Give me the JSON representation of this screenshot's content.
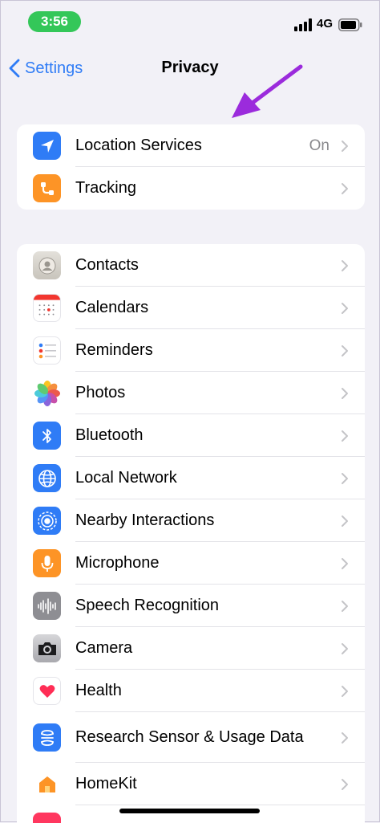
{
  "status_bar": {
    "time": "3:56",
    "network": "4G"
  },
  "nav": {
    "back_label": "Settings",
    "title": "Privacy"
  },
  "colors": {
    "accent": "#2f7cf6",
    "annotation_arrow": "#9b2bdc",
    "time_pill": "#34c759"
  },
  "group1": [
    {
      "label": "Location Services",
      "value": "On",
      "icon": "location-arrow-icon"
    },
    {
      "label": "Tracking",
      "value": "",
      "icon": "tracking-icon"
    }
  ],
  "group2": [
    {
      "label": "Contacts",
      "icon": "contacts-icon"
    },
    {
      "label": "Calendars",
      "icon": "calendar-icon"
    },
    {
      "label": "Reminders",
      "icon": "reminders-icon"
    },
    {
      "label": "Photos",
      "icon": "photos-icon"
    },
    {
      "label": "Bluetooth",
      "icon": "bluetooth-icon"
    },
    {
      "label": "Local Network",
      "icon": "globe-icon"
    },
    {
      "label": "Nearby Interactions",
      "icon": "nearby-icon"
    },
    {
      "label": "Microphone",
      "icon": "microphone-icon"
    },
    {
      "label": "Speech Recognition",
      "icon": "waveform-icon"
    },
    {
      "label": "Camera",
      "icon": "camera-icon"
    },
    {
      "label": "Health",
      "icon": "heart-icon"
    },
    {
      "label": "Research Sensor & Usage Data",
      "icon": "research-icon"
    },
    {
      "label": "HomeKit",
      "icon": "home-icon"
    }
  ]
}
